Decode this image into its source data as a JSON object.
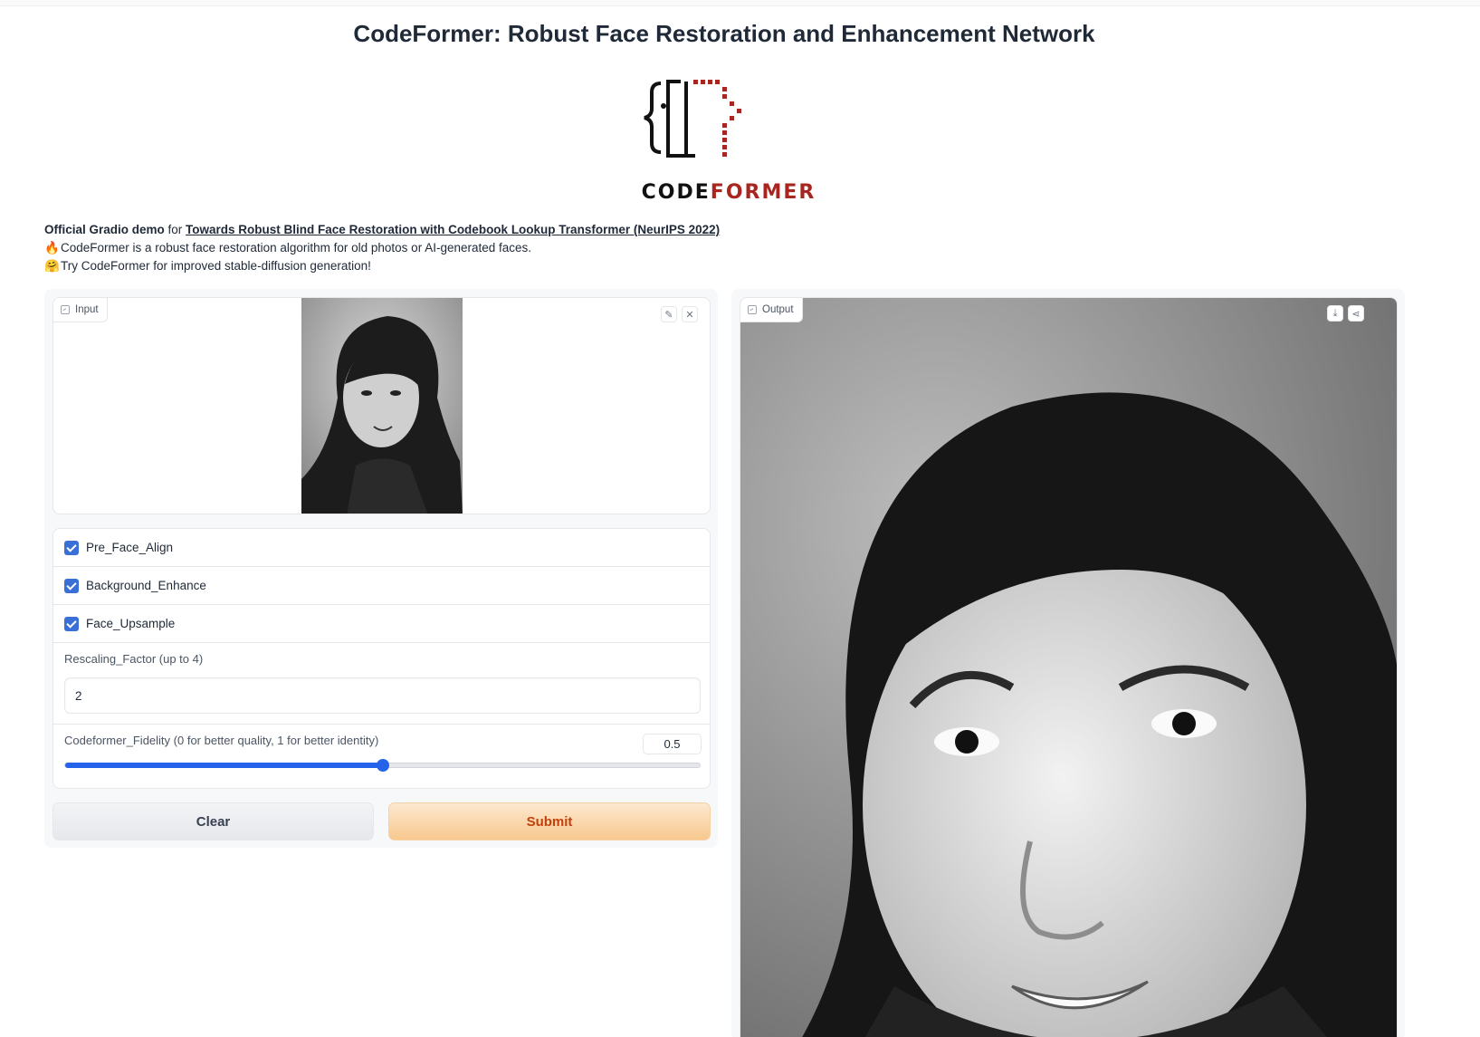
{
  "header": {
    "title": "CodeFormer: Robust Face Restoration and Enhancement Network"
  },
  "logo": {
    "word_code": "CODE",
    "word_former": "FORMER"
  },
  "intro": {
    "bold_prefix": "Official Gradio demo",
    "for_text": " for ",
    "paper_link": "Towards Robust Blind Face Restoration with Codebook Lookup Transformer (NeurIPS 2022)",
    "line2_emoji": "🔥",
    "line2_text": "CodeFormer is a robust face restoration algorithm for old photos or AI-generated faces.",
    "line3_emoji": "🤗",
    "line3_text": "Try CodeFormer for improved stable-diffusion generation!"
  },
  "input_panel": {
    "label": "Input",
    "icons": [
      "edit-icon",
      "close-icon"
    ]
  },
  "options": {
    "pre_face_align": {
      "label": "Pre_Face_Align",
      "checked": true
    },
    "background_enhance": {
      "label": "Background_Enhance",
      "checked": true
    },
    "face_upsample": {
      "label": "Face_Upsample",
      "checked": true
    },
    "rescaling": {
      "label": "Rescaling_Factor (up to 4)",
      "value": "2"
    },
    "fidelity": {
      "label": "Codeformer_Fidelity (0 for better quality, 1 for better identity)",
      "value": "0.5",
      "fraction": 0.5
    }
  },
  "buttons": {
    "clear": "Clear",
    "submit": "Submit"
  },
  "output_panel": {
    "label": "Output",
    "icons": [
      "download-icon",
      "share-icon"
    ]
  },
  "colors": {
    "accent": "#2563eb",
    "logo_red": "#a8261f",
    "submit_text": "#c2410c"
  }
}
